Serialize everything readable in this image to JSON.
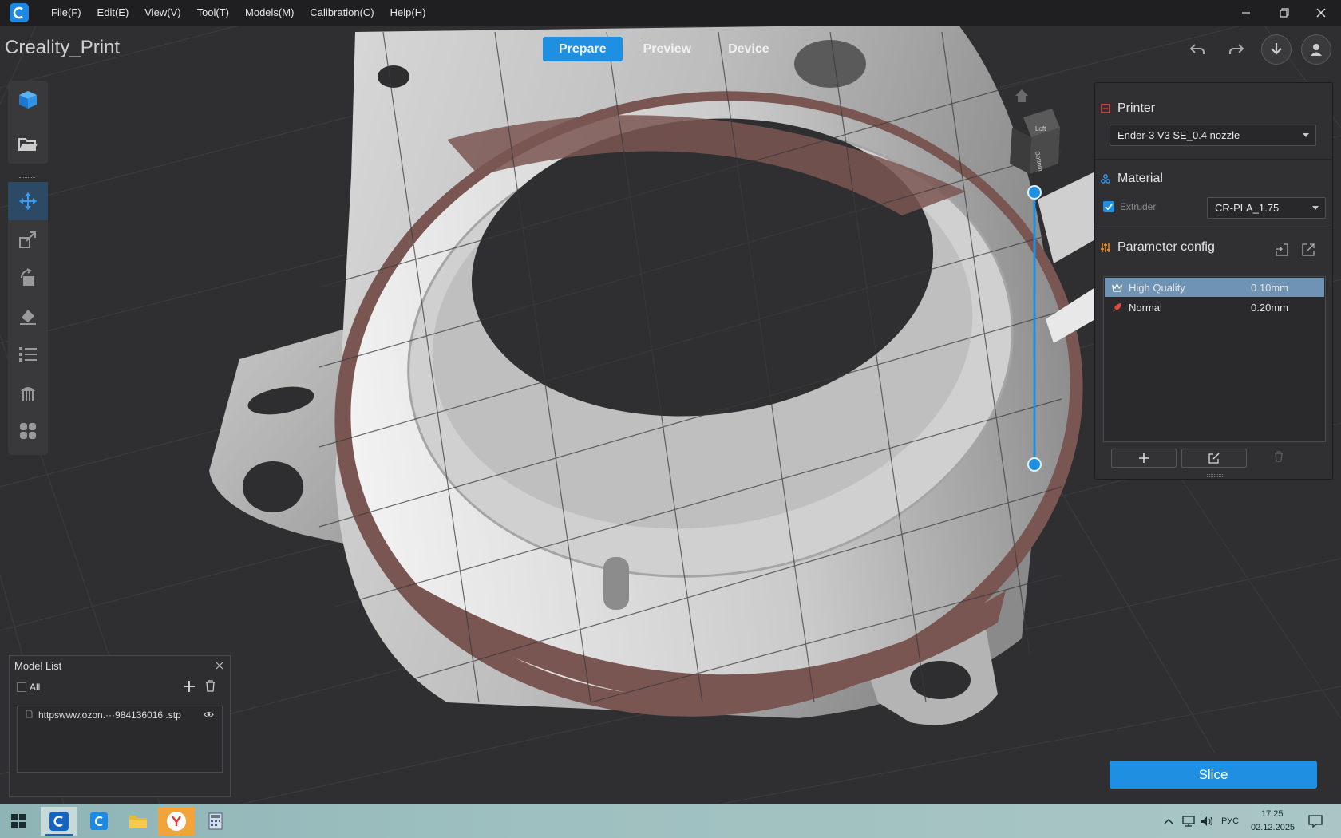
{
  "menu": [
    "File(F)",
    "Edit(E)",
    "View(V)",
    "Tool(T)",
    "Models(M)",
    "Calibration(C)",
    "Help(H)"
  ],
  "app_title": "Creality_Print",
  "tabs": [
    "Prepare",
    "Preview",
    "Device"
  ],
  "cube_labels": {
    "top": "Loft",
    "side": "Bottom"
  },
  "right_panel": {
    "printer_heading": "Printer",
    "printer_value": "Ender-3 V3 SE_0.4 nozzle",
    "material_heading": "Material",
    "extruder_label": "Extruder",
    "material_value": "CR-PLA_1.75",
    "param_heading": "Parameter config",
    "presets": [
      {
        "name": "High Quality",
        "value": "0.10mm"
      },
      {
        "name": "Normal",
        "value": "0.20mm"
      }
    ]
  },
  "slice_label": "Slice",
  "model_list": {
    "title": "Model List",
    "all_label": "All",
    "items": [
      "httpswww.ozon.···984136016 .stp"
    ]
  },
  "taskbar": {
    "lang": "РУС",
    "time": "17:25",
    "date": "02.12.2025"
  },
  "colors": {
    "accent": "#1e8fe1",
    "selected_row": "#6f93b5",
    "ring": "#7a5652"
  }
}
